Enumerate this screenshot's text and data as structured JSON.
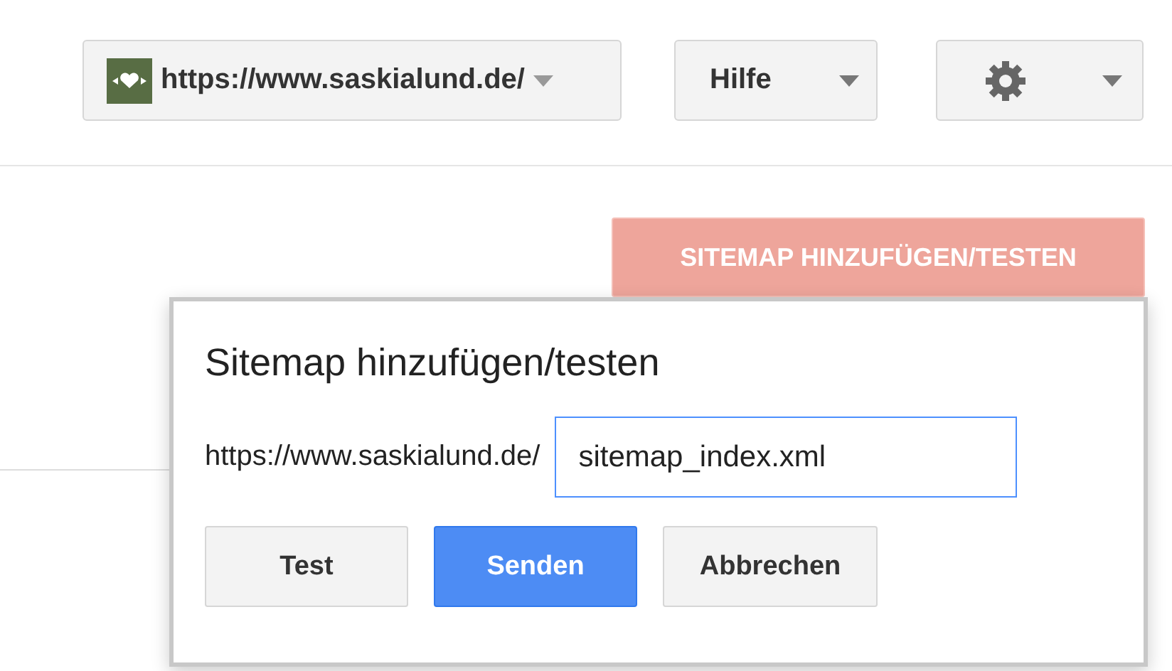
{
  "header": {
    "site_selector": {
      "label": "https://www.saskialund.de/"
    },
    "help_menu": {
      "label": "Hilfe"
    }
  },
  "add_sitemap_button": {
    "label": "SITEMAP HINZUFÜGEN/TESTEN"
  },
  "dialog": {
    "title": "Sitemap hinzufügen/testen",
    "url_prefix": "https://www.saskialund.de/",
    "input": {
      "value": "sitemap_index.xml"
    },
    "buttons": [
      {
        "label": "Test",
        "kind": "plain"
      },
      {
        "label": "Senden",
        "kind": "primary"
      },
      {
        "label": "Abbrechen",
        "kind": "plain"
      }
    ]
  }
}
